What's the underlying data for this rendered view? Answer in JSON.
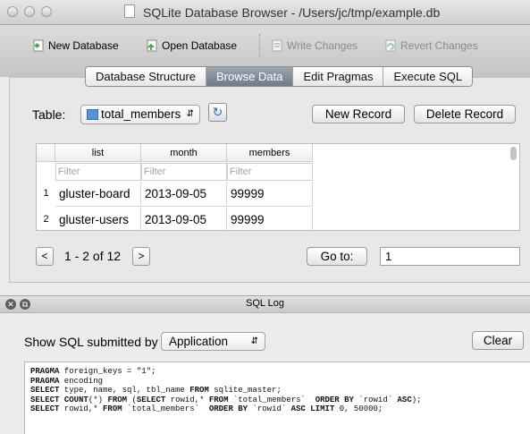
{
  "window": {
    "title": "SQLite Database Browser - /Users/jc/tmp/example.db"
  },
  "toolbar": {
    "new_database": "New Database",
    "open_database": "Open Database",
    "write_changes": "Write Changes",
    "revert_changes": "Revert Changes"
  },
  "tabs": [
    "Database Structure",
    "Browse Data",
    "Edit Pragmas",
    "Execute SQL"
  ],
  "active_tab": "Browse Data",
  "browse": {
    "table_label": "Table:",
    "table_selected": "total_members",
    "new_record": "New Record",
    "delete_record": "Delete Record",
    "columns": [
      "list",
      "month",
      "members"
    ],
    "filter_placeholder": "Filter",
    "rows": [
      {
        "num": "1",
        "cells": [
          "gluster-board",
          "2013-09-05",
          "99999"
        ]
      },
      {
        "num": "2",
        "cells": [
          "gluster-users",
          "2013-09-05",
          "99999"
        ]
      }
    ],
    "prev": "<",
    "next": ">",
    "pager_text": "1 - 2 of 12",
    "goto_label": "Go to:",
    "goto_value": "1"
  },
  "sql_log": {
    "title": "SQL Log",
    "show_label": "Show SQL submitted by",
    "source_selected": "Application",
    "clear": "Clear",
    "lines": [
      "PRAGMA foreign_keys = \"1\";",
      "PRAGMA encoding",
      "SELECT type, name, sql, tbl_name FROM sqlite_master;",
      "SELECT COUNT(*) FROM (SELECT rowid,* FROM `total_members`  ORDER BY `rowid` ASC);",
      "SELECT rowid,* FROM `total_members`  ORDER BY `rowid` ASC LIMIT 0, 50000;"
    ]
  },
  "colors": {
    "active_tab": "#7a8592",
    "refresh_icon": "#2f6fc6",
    "toolbar_icon_green": "#3fa34d"
  }
}
